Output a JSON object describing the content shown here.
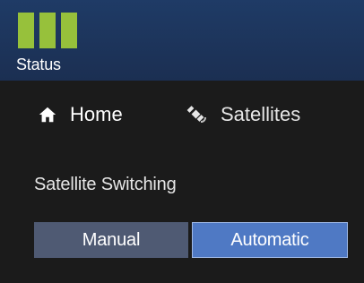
{
  "header": {
    "status_label": "Status",
    "status_icon": "status-bars-icon",
    "accent_color": "#97c13b"
  },
  "nav": {
    "home_label": "Home",
    "home_icon": "home-icon",
    "satellites_label": "Satellites",
    "satellites_icon": "satellite-icon"
  },
  "main": {
    "section_title": "Satellite Switching",
    "toggle": {
      "options": [
        "Manual",
        "Automatic"
      ],
      "selected": "Automatic"
    }
  }
}
